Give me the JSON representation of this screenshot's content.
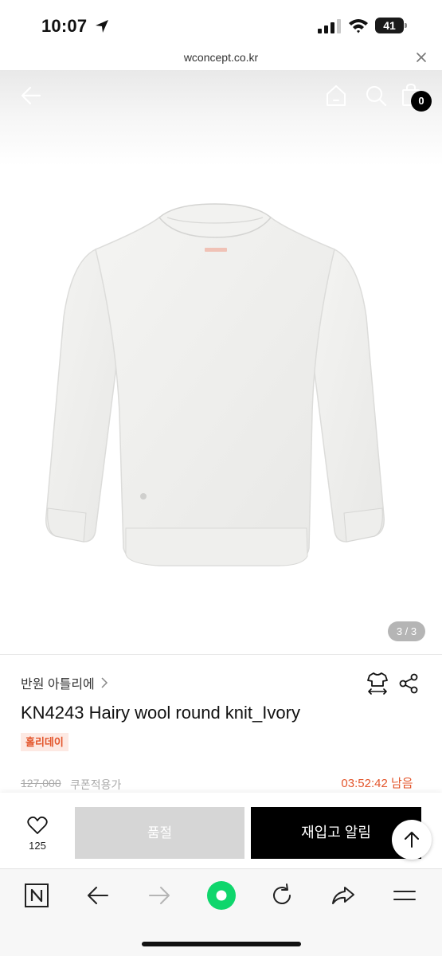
{
  "status_bar": {
    "time": "10:07",
    "battery": "41"
  },
  "browser": {
    "url": "wconcept.co.kr"
  },
  "header": {
    "cart_count": "0"
  },
  "gallery": {
    "counter": "3 / 3"
  },
  "product": {
    "brand": "반원 아틀리에",
    "title": "KN4243 Hairy wool round knit_Ivory",
    "badge": "홀리데이",
    "original_price": "127,000",
    "coupon_text": "쿠폰적용가",
    "timer": "03:52:42 남음"
  },
  "actions": {
    "like_count": "125",
    "soldout_label": "품절",
    "restock_label": "재입고 알림"
  },
  "colors": {
    "accent": "#e3552b",
    "badge_bg": "#fde9e3",
    "soldout_bg": "#d6d6d6",
    "primary_button": "#000000",
    "toolbar_green": "#0fd66c"
  },
  "icons": {
    "location": "location-arrow-icon",
    "signal": "signal-bars-icon",
    "wifi": "wifi-icon",
    "close": "close-icon",
    "back": "back-arrow-icon",
    "home": "home-icon",
    "search": "search-icon",
    "cart": "shopping-bag-icon",
    "size": "size-guide-shirt-icon",
    "share": "share-icon",
    "like": "heart-icon",
    "top": "arrow-up-icon",
    "naver": "n-logo-icon",
    "reload": "reload-icon"
  }
}
